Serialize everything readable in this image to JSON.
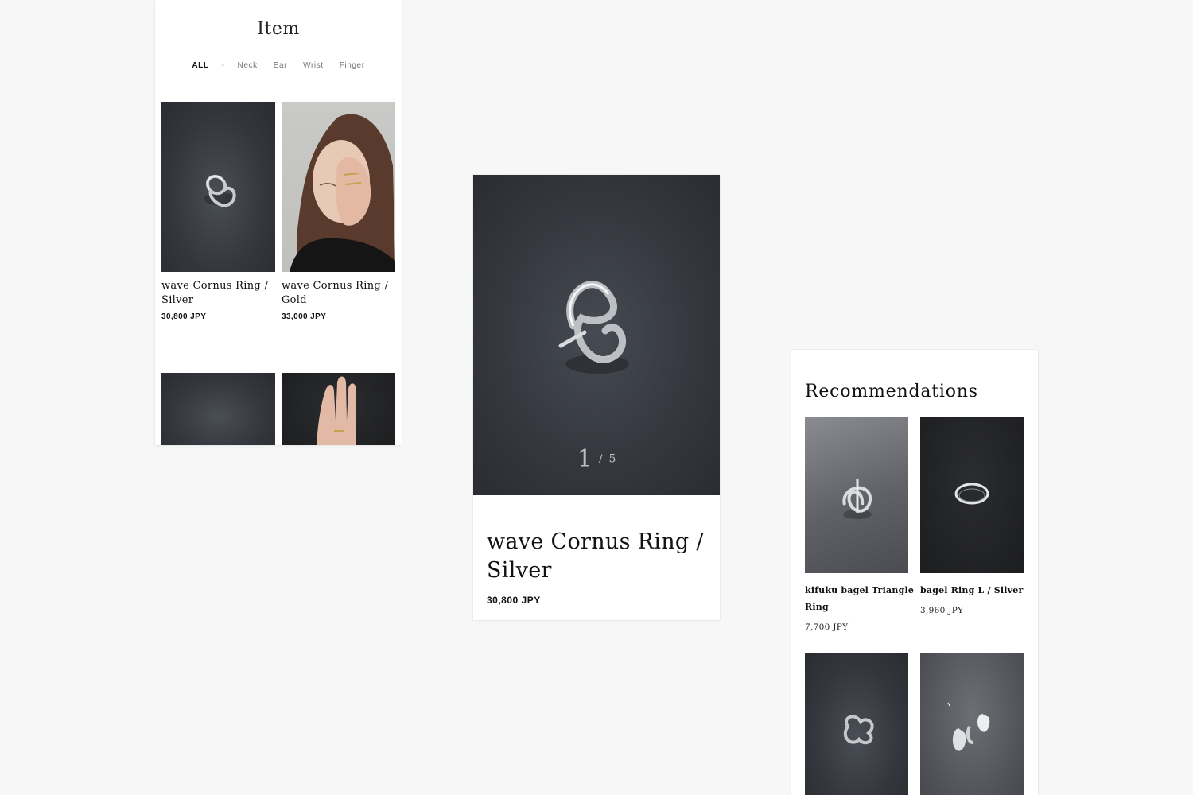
{
  "list_screen": {
    "title": "Item",
    "filters": [
      "ALL",
      "-",
      "Neck",
      "Ear",
      "Wrist",
      "Finger"
    ],
    "active_filter": "ALL",
    "products": [
      {
        "name_line1": "wave Cornus Ring /",
        "name_line2": "Silver",
        "price": "30,800 JPY",
        "image": "silver-ring-photo"
      },
      {
        "name_line1": "wave Cornus Ring /",
        "name_line2": "Gold",
        "price": "33,000 JPY",
        "image": "model-wearing-gold-ring-photo"
      }
    ]
  },
  "detail_screen": {
    "pager": {
      "current": "1",
      "separator": "/",
      "total": "5"
    },
    "name_line1": "wave Cornus Ring /",
    "name_line2": "Silver",
    "price": "30,800 JPY"
  },
  "reco_screen": {
    "title": "Recommendations",
    "items": [
      {
        "name_line1": "kifuku bagel Triangle",
        "name_line2": "Ring",
        "price": "7,700 JPY"
      },
      {
        "name_line1": "bagel Ring L / Silver",
        "name_line2": "",
        "price": "3,960 JPY"
      }
    ]
  },
  "colors": {
    "page_bg": "#f7f7f7",
    "card_bg": "#ffffff",
    "text": "#111111",
    "pager": "#bfbfbf"
  }
}
